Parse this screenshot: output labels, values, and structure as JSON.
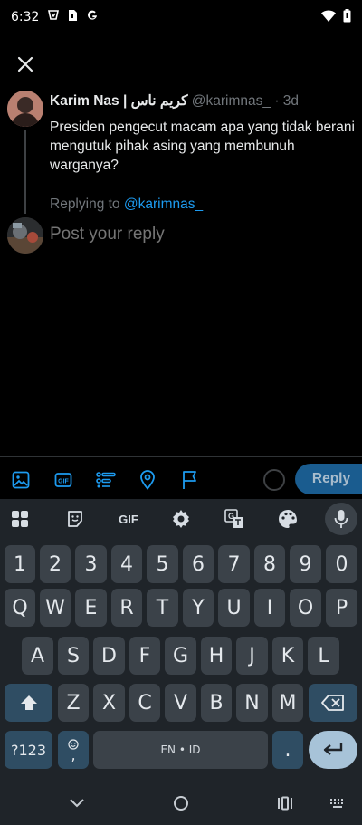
{
  "status_bar": {
    "time": "6:32"
  },
  "tweet": {
    "name": "Karim Nas | كريم ناس",
    "handle": "@karimnas_",
    "separator": "·",
    "age": "3d",
    "body": "Presiden pengecut macam apa yang tidak berani mengutuk pihak asing yang membunuh warganya?"
  },
  "replying": {
    "prefix": "Replying to ",
    "mention": "@karimnas_"
  },
  "compose": {
    "placeholder": "Post your reply",
    "reply_label": "Reply"
  },
  "keyboard": {
    "toolbar": {
      "gif_label": "GIF"
    },
    "number_row": [
      "1",
      "2",
      "3",
      "4",
      "5",
      "6",
      "7",
      "8",
      "9",
      "0"
    ],
    "row1": [
      "Q",
      "W",
      "E",
      "R",
      "T",
      "Y",
      "U",
      "I",
      "O",
      "P"
    ],
    "row2": [
      "A",
      "S",
      "D",
      "F",
      "G",
      "H",
      "J",
      "K",
      "L"
    ],
    "row3": [
      "Z",
      "X",
      "C",
      "V",
      "B",
      "N",
      "M"
    ],
    "symbols_label": "?123",
    "emoji_comma_label": ",",
    "space_label": "EN • ID",
    "period_label": "."
  },
  "colors": {
    "background": "#000000",
    "accent": "#1d9bf0",
    "reply_button": "#1a5c8f",
    "keyboard_bg": "#1f2429",
    "key_bg": "#3b4249"
  }
}
